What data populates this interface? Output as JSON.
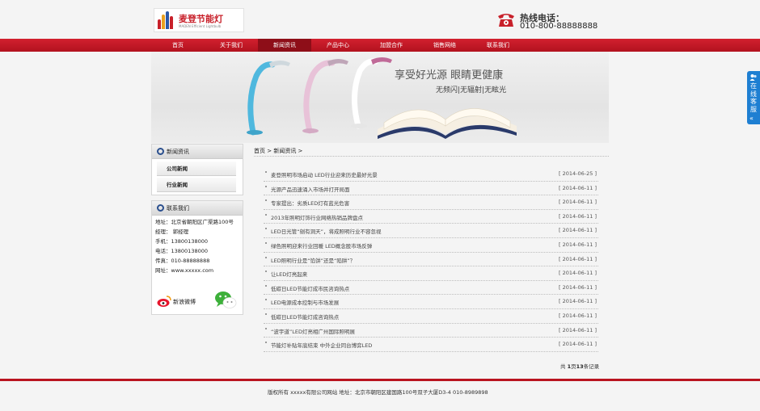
{
  "header": {
    "logo_text": "麦登节能灯",
    "logo_sub": "MADEN Efficient Lightbulb",
    "hotline_label": "热线电话：",
    "hotline_number": "010-800-88888888"
  },
  "nav": {
    "items": [
      "首页",
      "关于我们",
      "新闻资讯",
      "产品中心",
      "加盟合作",
      "销售网络",
      "联系我们"
    ],
    "active_index": 2
  },
  "banner": {
    "title": "享受好光源 眼睛更健康",
    "subtitle": "无频闪|无辐射|无眩光"
  },
  "sidebar": {
    "news_title": "新闻资讯",
    "news_links": [
      "公司新闻",
      "行业新闻"
    ],
    "contact_title": "联系我们",
    "contact_lines": [
      "地址：北京省朝阳区广渠路100号",
      "经理： 郭经理",
      "手机：13800138000",
      "电话：13800138000",
      "传真：010-88888888",
      "网址：www.xxxxx.com"
    ],
    "weibo_label": "新浪微博"
  },
  "breadcrumb": "首页 > 新闻资讯 >",
  "news": [
    {
      "title": "麦登照明市场启动 LED行业迎来历史最好光景",
      "date": "[ 2014-06-25 ]"
    },
    {
      "title": "光源产品迅速涌入市场并打开局面",
      "date": "[ 2014-06-11 ]"
    },
    {
      "title": "专家提出：劣质LED灯有蓝光危害",
      "date": "[ 2014-06-11 ]"
    },
    {
      "title": "2013年照明灯饰行业网络热销品牌盘点",
      "date": "[ 2014-06-11 ]"
    },
    {
      "title": "LED日光管“剜有洞天”，将成照明行业不容忽视",
      "date": "[ 2014-06-11 ]"
    },
    {
      "title": "绿色照明迎来行业回暖 LED概念股市场反弹",
      "date": "[ 2014-06-11 ]"
    },
    {
      "title": "LED照明行业是“馅饼”还是“陷阱”？",
      "date": "[ 2014-06-11 ]"
    },
    {
      "title": "让LED灯亮起来",
      "date": "[ 2014-06-11 ]"
    },
    {
      "title": "低碳日LED节能灯成市民咨询热点",
      "date": "[ 2014-06-11 ]"
    },
    {
      "title": "LED电源成本控制与市场发展",
      "date": "[ 2014-06-11 ]"
    },
    {
      "title": "低碳日LED节能灯成咨询热点",
      "date": "[ 2014-06-11 ]"
    },
    {
      "title": "“波宇道”LED灯亮相广州国际照明展",
      "date": "[ 2014-06-11 ]"
    },
    {
      "title": "节能灯补贴年底结束 中外企业同台博弈LED",
      "date": "[ 2014-06-11 ]"
    }
  ],
  "pager": {
    "prefix": "共 ",
    "pages": "1",
    "mid": "页",
    "count": "13",
    "suffix": "条记录"
  },
  "footer": "版权所有 xxxxx有限公司网站 地址：北京市朝阳区建国路100号双子大厦D3-4 010-8989898",
  "online_service": {
    "label": "在线客服",
    "arrow": "«"
  },
  "colors": {
    "brand_red": "#c8202a",
    "nav_active": "#8e0e18",
    "online_blue": "#1e7fd2"
  }
}
